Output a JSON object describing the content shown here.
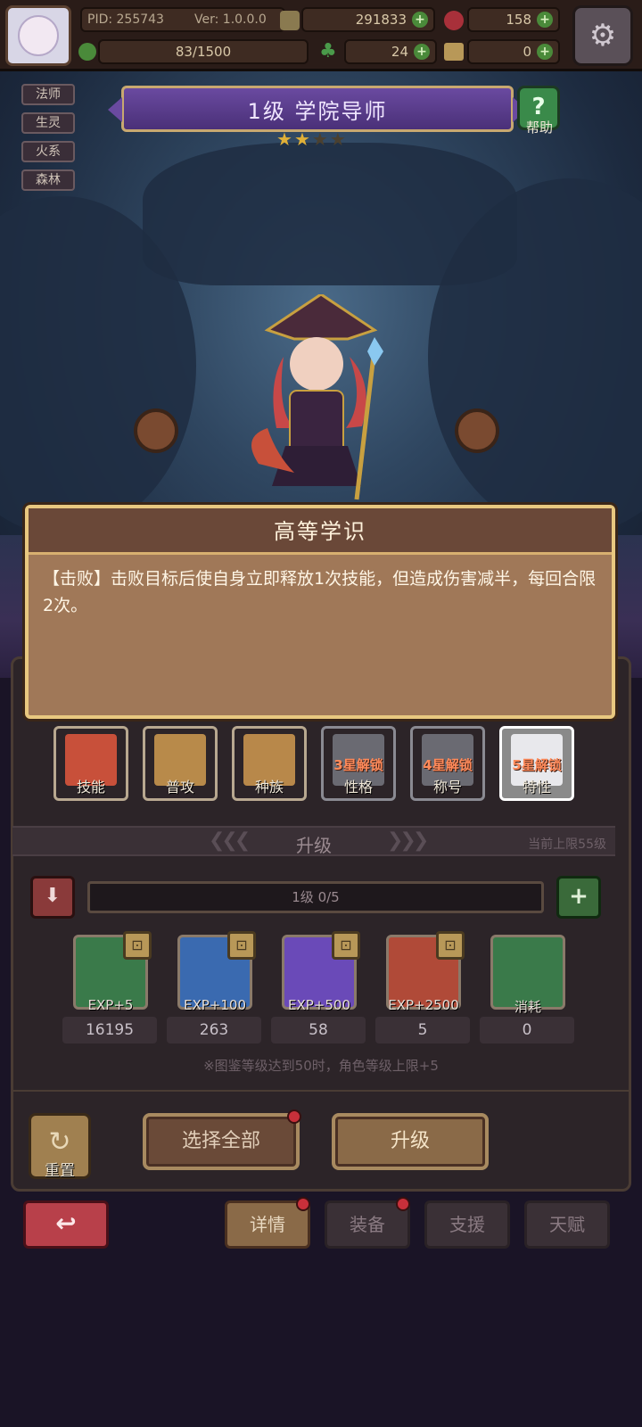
{
  "player": {
    "pid_text": "PID: 255743",
    "version_text": "Ver: 1.0.0.0",
    "coins": "291833",
    "gems": "158",
    "stamina": "83/1500",
    "clovers": "24",
    "hammers": "0"
  },
  "tags": [
    "法师",
    "生灵",
    "火系",
    "森林"
  ],
  "hero": {
    "title": "1级  学院导师",
    "stars_filled": 2,
    "stars_total": 4,
    "help_label": "帮助",
    "help_symbol": "?"
  },
  "tooltip": {
    "title": "高等学识",
    "body": "【击败】击败目标后使自身立即释放1次技能，但造成伤害减半，每回合限2次。"
  },
  "tabs": [
    {
      "label": "技能",
      "lock": "",
      "color": "#c8503a"
    },
    {
      "label": "普攻",
      "lock": "",
      "color": "#b88a4a"
    },
    {
      "label": "种族",
      "lock": "",
      "color": "#b8884a"
    },
    {
      "label": "性格",
      "lock": "3星解锁",
      "color": "#6a6a72"
    },
    {
      "label": "称号",
      "lock": "4星解锁",
      "color": "#6a6a72"
    },
    {
      "label": "特性",
      "lock": "5星解锁",
      "color": "#e8e8ec"
    }
  ],
  "upgrade": {
    "section_title": "升级",
    "cap_text": "当前上限55级",
    "level_text": "1级  0/5",
    "minus_symbol": "⬇",
    "plus_symbol": "+"
  },
  "items": [
    {
      "label": "EXP+5",
      "count": "16195",
      "color": "#3a7a4a"
    },
    {
      "label": "EXP+100",
      "count": "263",
      "color": "#3a6ab0"
    },
    {
      "label": "EXP+500",
      "count": "58",
      "color": "#6a4ab8"
    },
    {
      "label": "EXP+2500",
      "count": "5",
      "color": "#b04a38"
    },
    {
      "label": "消耗",
      "count": "0",
      "color": "#3a7a4a"
    }
  ],
  "note": "※图鉴等级达到50时，角色等级上限+5",
  "actions": {
    "reset_label": "重置",
    "select_all_label": "选择全部",
    "upgrade_label": "升级"
  },
  "nav": {
    "back_symbol": "↩",
    "details": "详情",
    "equipment": "装备",
    "support": "支援",
    "talent": "天赋"
  }
}
